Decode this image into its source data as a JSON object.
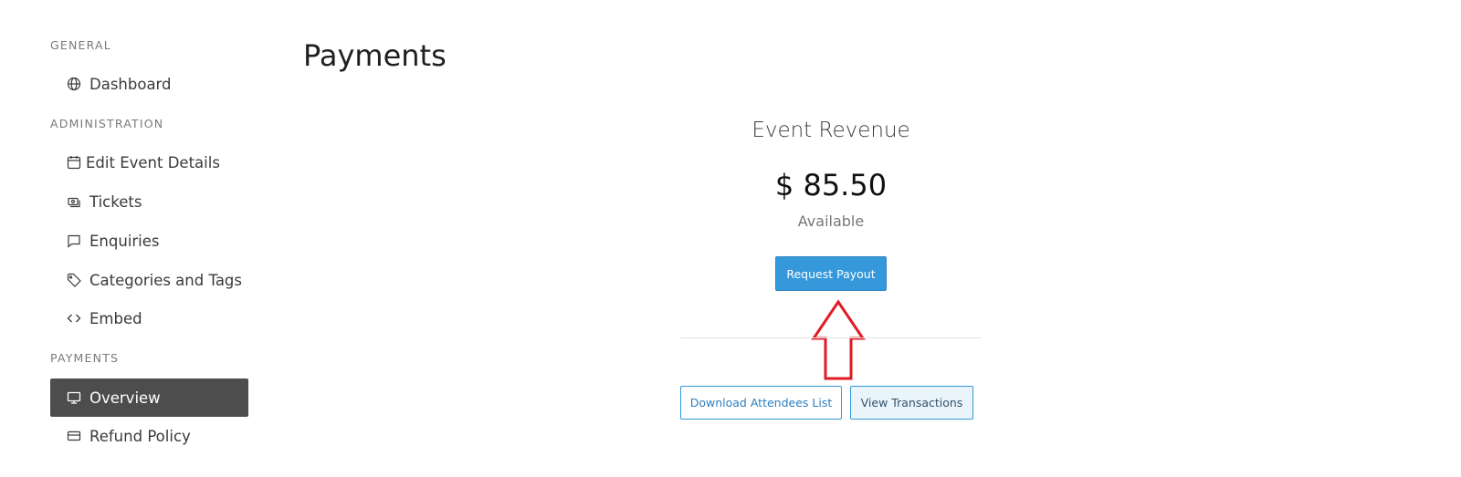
{
  "sidebar": {
    "sections": [
      {
        "label": "GENERAL",
        "items": [
          {
            "label": "Dashboard",
            "icon": "globe-icon"
          }
        ]
      },
      {
        "label": "ADMINISTRATION",
        "items": [
          {
            "label": "Edit Event Details",
            "icon": "calendar-icon"
          },
          {
            "label": "Tickets",
            "icon": "ticket-icon"
          },
          {
            "label": "Enquiries",
            "icon": "chat-bubble-icon"
          },
          {
            "label": "Categories and Tags",
            "icon": "tag-icon"
          },
          {
            "label": "Embed",
            "icon": "code-icon"
          }
        ]
      },
      {
        "label": "PAYMENTS",
        "items": [
          {
            "label": "Overview",
            "icon": "monitor-icon",
            "active": true
          },
          {
            "label": "Refund Policy",
            "icon": "credit-card-icon"
          }
        ]
      }
    ]
  },
  "main": {
    "title": "Payments",
    "revenue": {
      "title": "Event Revenue",
      "amount": "$ 85.50",
      "subtitle": "Available"
    },
    "request_payout_label": "Request Payout",
    "download_attendees_label": "Download Attendees List",
    "view_transactions_label": "View Transactions"
  },
  "colors": {
    "accent": "#3498db",
    "active_nav": "#4d4d4d",
    "annotation_arrow": "#e01b24"
  }
}
